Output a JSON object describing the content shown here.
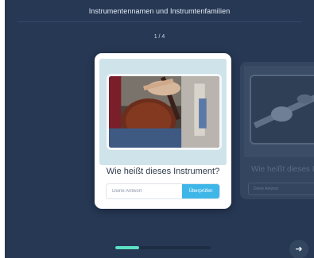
{
  "header": {
    "title": "Instrumentennamen und Instrumtenfamilien"
  },
  "counter": {
    "text": "1 / 4"
  },
  "card": {
    "question": "Wie heißt dieses Instrument?",
    "answer_placeholder": "Deine Antwort",
    "answer_value": "",
    "check_label": "Überprüfen"
  },
  "next_card": {
    "question": "Wie heißt dieses In",
    "answer_placeholder": "Deine Antwort"
  },
  "progress": {
    "fraction": 0.25
  },
  "icons": {
    "next": "arrow-right-icon"
  },
  "colors": {
    "background": "#263854",
    "accent": "#3fb6e8",
    "progress": "#5ce0c3"
  }
}
